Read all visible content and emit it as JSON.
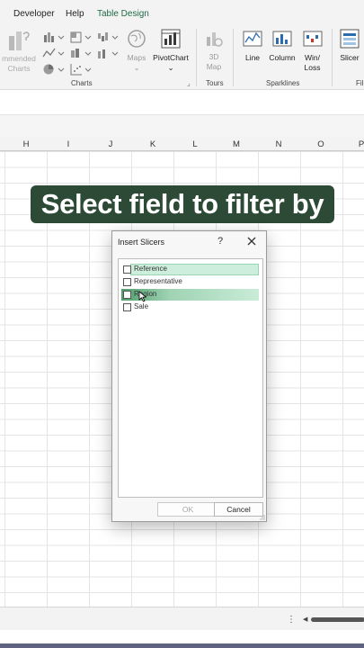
{
  "menu": {
    "tabs": [
      "Developer",
      "Help",
      "Table Design"
    ],
    "active_tab": "Table Design"
  },
  "ribbon": {
    "partial_label_1": "mmended",
    "partial_label_2": "Charts",
    "maps_label": "Maps",
    "pivotchart_label": "PivotChart",
    "map3d_label_1": "3D",
    "map3d_label_2": "Map",
    "line_label": "Line",
    "column_label": "Column",
    "winloss_label_1": "Win/",
    "winloss_label_2": "Loss",
    "slicer_label": "Slicer",
    "filter_partial": "Fil",
    "groups": {
      "charts": "Charts",
      "tours": "Tours",
      "sparklines": "Sparklines"
    },
    "accent_color": "#1f6b46"
  },
  "columns": [
    "H",
    "I",
    "J",
    "K",
    "L",
    "M",
    "N",
    "O",
    "P"
  ],
  "caption": {
    "text": "Select field to filter by",
    "background": "#2d4a36"
  },
  "dialog": {
    "title": "Insert Slicers",
    "help": "?",
    "fields": [
      {
        "label": "Reference",
        "checked": false,
        "highlighted": true
      },
      {
        "label": "Representative",
        "checked": false,
        "highlighted": false
      },
      {
        "label": "Region",
        "checked": false,
        "highlighted": true,
        "hovered": true
      },
      {
        "label": "Sale",
        "checked": false,
        "highlighted": false
      }
    ],
    "ok_label": "OK",
    "cancel_label": "Cancel",
    "highlight_color": "#cdeedd",
    "hover_color": "#5ea879"
  },
  "bottom_bar": {
    "more": "⋮"
  }
}
